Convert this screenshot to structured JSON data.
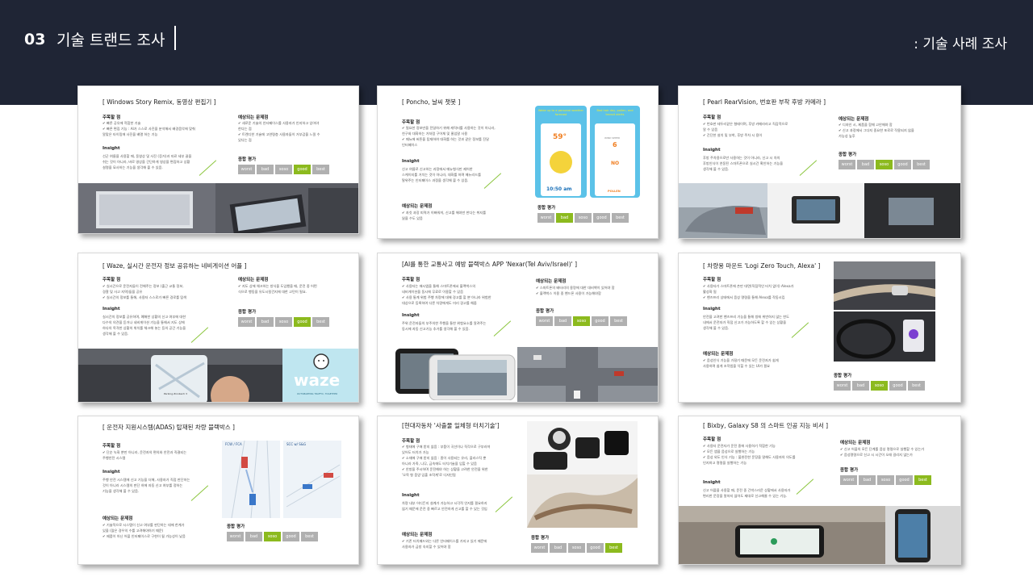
{
  "header": {
    "number": "03",
    "title": "기술 트랜드 조사",
    "right_label": ": 기술 사례 조사"
  },
  "labels": {
    "focus": "주목할 점",
    "issues": "예상되는 문제점",
    "insight": "Insight",
    "rating": "종합 평가"
  },
  "rating_scale": [
    "worst",
    "bad",
    "soso",
    "good",
    "best"
  ],
  "colors": {
    "header_bg": "#1f2535",
    "accent_green": "#8cba1e",
    "rating_grey": "#b0b0b0"
  },
  "cards": [
    {
      "title": "[ Windows Story Remix, 동영상 편집기 ]",
      "focus": "✔ 빠른 공유에 적합한 기술\n✔ 빠른 편집 기능 : AI가 스스로 사진을 분석해서 배경음악에 맞춰\n    알맞은 타이밍에 사진을 배열 하는 기능",
      "issues": "✔ 새로운 기술의 인터페이스를 사용자가 인지하고 있어야\n    한다는 점\n✔ 트렌디한 기술에 고연령층 사용자들이 거부감을 느낄 수\n    있다는 점",
      "insight": "선군 여름을 사용할 때, 동영상 및 사진 (증거)과 자료 세부 끌을\n쉬는 것이 아니라, 바로 영상을 간단하게 영상을 편집하고 상황\n설명을 묘사하는 기능을 생각해 볼 수 있음.",
      "rating": "good"
    },
    {
      "title": "[ Poncho, 날씨 챗봇 ]",
      "focus": "✔ 필요한 정보만을 전달하기 위해 캐릭터를 사용하는 것이 아니라,\n    친구와 대화하는 거처럼 구어체 및 줄임말 사용\n✔ 메뉴에 버튼을 탑재하여 대화를 하는 것과 같은 정보를 진달\n    인터페이스",
      "insight": "신고 여름로 신고하는 과정에서 메뉴형식만 제어한\n스케이지를 거치는 것이 아니라, 대화를 하며 메뉴리드를\n탈위주는 인터페이스 과정을 생각해 볼 수 있음.",
      "issues": "✔ 자칫 과장 피력가 이뻐워져, 신고를 해야만 한다는 취지를\n    잃을 수도 있음",
      "rating": "bad",
      "phone1_text": "Wake up to a personal weather forecast",
      "phone2_text": "Bad hair day, pollen, and transit alerts",
      "temp": "59°",
      "time": "10:50 am",
      "wind": "6",
      "wind_label": "WIND SPEED",
      "no_label": "NO",
      "pollen": "POLLEN"
    },
    {
      "title": "[ Pearl RearVision, 번호판 부착 후방 카메라 ]",
      "focus": "✔ 번호판 테두리같은 형태이며, 후방 카메라라고 직감적으로\n    알 수 있음\n✔ 간단한 설치 및 부착, 후방 주차 시 용이",
      "issues": "✔ 디자인 시, 제품을 함께 고안해야 함\n✔ 신고 과정에서 그다지 중요한 포로로 작용되지 않을\n    가능성 높후",
      "insight": "후방 주차용으로만 사용하는 것이 아니라, 신고 시 차의\n후방인식이 연동된 스마트폰으로 실시간 확인하는 기능을\n생각해 볼 수 있음.",
      "rating": "soso"
    },
    {
      "title": "[ Waze, 실시간 운전자 정보 공유하는 네비게이션 어플 ]",
      "focus": "✔ 실시간으로 운전자들이 전해주는 정보 (출근 교통 정보,\n    경찰 및 사고 지역)들을 공유\n✔ 실시간의 정보를 통해, 사용자 스스로가 빠른 경로를 탐색",
      "issues": "✔ 지도 상에 체크하는 방식을 도입했을 때, 운전 중 어떤\n    식으로 행동을 유도시킬건지에 대한 고민이 필요.",
      "insight": "실시간의 정보를 공유하며, 예해한 상황의 신고 여부에 대한\n다수의 의견을 듣거나 네비게이션 기능을 통해서 지도 상에\n하다의 목격한 상황의 위치를 체크해 놓는 등의 공간 기능을\n생각해 볼 수 있음.",
      "rating": "good",
      "logo_text": "waze",
      "logo_tag": "OUTSMARTING TRAFFIC, TOGETHER",
      "parking_label": "Parking Zinnbach 3"
    },
    {
      "title": "[AI를 통한 교통사고 예방 블랙박스 APP 'Nexar(Tel Aviv/Israel)' ]",
      "focus": "✔ 사용자는 애시앱을 통해 스마트폰에서 블랙박스의\n    네비게이션을 동시에 무료로 이용할 수 있음\n✔ 사용 통계 위험 주행 차량에 대해 경고를 할 뿐 아니라 위험한\n    대상으로 등록하여 다른 차량에게도 미리 경고를 해줌",
      "issues": "✔ 스마트폰의 배터리의 용량에 대한 대비책이 있어야 함\n✔ 블랙박스 이용 중 핸드폰 사용이 가능해야함",
      "insight": "주위 운전자들의 부주의한 주행을 통한 위험요소를 알려주는\n동시에 자동 신고기능 추가를 생각해 볼 수 있음.",
      "rating": "soso"
    },
    {
      "title": "[ 차량용 마운트 'Logi Zero Touch, Alexa' ]",
      "focus": "✔ 사용자가 스마트폰에 손만 대면(직접적인 터치 없이) Alexa가\n    활성화 됨\n✔ 핸즈프리 상태에서 음성 명령을 통해 Alexa를 작동시킴",
      "insight": "안전을 고려한 핸즈프리 기능을 통해 빙에 위반하지 않는 한도\n내에서 운전자가 직접 신고가 가능하도록 할 수 있는 상황을\n생각해 볼 수 있음.",
      "issues": "✔ 음성인식 기능을 가졌기 때문에 모든 운전자가 쉽게\n    사용하며 쉽게 조작법을 익힐 수 있는 UI가 필요",
      "rating": "soso"
    },
    {
      "title": "[ 운전자 지원시스템(ADAS) 탑재된 차량 블랙박스 ]",
      "focus": "✔ 단순 녹화 뿐만 아니라, 운전자의 편의와 안전과 직결되는\n    주행안전 시스템",
      "insight": "주행 안전 시스템에 신고 기능을 더해, 사용자가 직접 판단하는\n것이 아니라 시스템의 판단 하에 자동 신고 여부를 정하는\n기능을 생각해 볼 수 있음.",
      "issues": "✔ 기술적으로 시스템이 신고 여부를 판단하는 데에 한계가\n    있을 (많은 경우의 수를 고려해야하기 때문)\n✔ 제품이 아닌 어플 인터페이스로 구현이 될 가능성이 낮음",
      "rating": "soso",
      "diag1_label": "FCW / FCA",
      "diag2_label": "SCC w/ S&G"
    },
    {
      "title": "[현대자동차 '사출물 일체형 터치기술']",
      "focus": "✔ 형태에 구애 받지 않음 : 부품이 곡선이나 직각으로 구부러져\n    있어도 터치가 가능\n✔ 소재에 구애 받지 않음 : 종이 사용되는 유리, 플라스틱 뿐\n    아니라 가죽, 나무, 금속에도 터치기술을 입힐 수 있음\n✔ 안방을 주시하며 운전해야 하는 상황을 고려한 안전을 위한\n    '오목 형 음양 입출 조작계'로 디자인됨",
      "insight": "차량 내부 어디든지 설계가 가능하고 시각적 인지를 필요하지\n않기 때문에 운전 중 빠르고 안전하게 신고를 할 수 있는 것임",
      "issues": "✔ 기존 터치패드와는 다른 인터페이스를 가지고 있기 때문에\n    사용자가 금방 숙지할 수 있어야 함",
      "rating": "best"
    },
    {
      "title": "[ Bixby, Galaxy S8 의 스마트 인공 지능 비서 ]",
      "focus": "✔ 사용자 운전자가 운전 중에 사용하기 적합한 기능\n✔ 모든 앱을 음성으로 실행하는 기능\n✔ 음성 외도 인식 기능 : 불완전한 문장을 말해도 사용자의 의도를\n    인지하고 명령을 실행하는 기능",
      "issues": "✔ 신고 어플의 모든 단계를 음성 명령으로 실행할 수 있는가\n✔ 음성명령으로 신고 시 시간이 오래 걸리지 않는가",
      "insight": "신고 어플을 사용할 때, 운전 중 긴박스러운 상황에서 사용자가\n편리한 문장을 말하지 않아도 제대로 신고해줄 수 있는 기능.",
      "rating": "best"
    }
  ]
}
